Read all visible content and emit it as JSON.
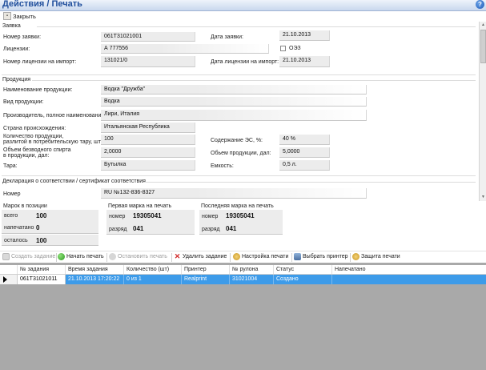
{
  "window": {
    "title": "Действия / Печать",
    "help": "?"
  },
  "closebar": {
    "close_label": "Закрыть"
  },
  "application": {
    "section": "Заявка",
    "number_label": "Номер заявки:",
    "number_value": "061T31021001",
    "date_label": "Дата заявки:",
    "date_value": "21.10.2013",
    "license_label": "Лицензии:",
    "license_value": "А 777556",
    "oez_label": "ОЭЗ",
    "import_license_label": "Номер лицензии на импорт:",
    "import_license_value": "131021/0",
    "import_date_label": "Дата лицензии на импорт:",
    "import_date_value": "21.10.2013"
  },
  "product": {
    "section": "Продукция",
    "name_label": "Наименование продукции:",
    "name_value": "Водка \"Дружба\"",
    "kind_label": "Вид продукции:",
    "kind_value": "Водка",
    "producer_label": "Производитель, полное наименование",
    "producer_value": "Лири, Италия",
    "country_label": "Страна происхождения:",
    "country_value": "Итальянская Республика",
    "qty_label_1": "Количество продукции,",
    "qty_label_2": "разлитой в потребительскую тару, шт:",
    "qty_value": "100",
    "alc_label": "Содержание ЭС, %:",
    "alc_value": "40 %",
    "spirit_label_1": "Объем безводного спирта",
    "spirit_label_2": "в продукции, дал:",
    "spirit_value": "2,0000",
    "volume_label": "Обьем продукции, дал:",
    "volume_value": "5,0000",
    "tare_label": "Тара:",
    "tare_value": "Бутылка",
    "capacity_label": "Емкость:",
    "capacity_value": "0,5 л."
  },
  "declaration": {
    "section": "Декларация о соответствии / сертификат соответствия",
    "number_label": "Номер",
    "number_value": "RU №132-836-8327"
  },
  "marks": {
    "title": "Марок в позиции",
    "total_label": "всего",
    "total_value": "100",
    "printed_label": "напечатано",
    "printed_value": "0",
    "left_label": "осталось",
    "left_value": "100"
  },
  "first_mark": {
    "title": "Первая марка на печать",
    "number_label": "номер",
    "number_value": "19305041",
    "rank_label": "разряд",
    "rank_value": "041"
  },
  "last_mark": {
    "title": "Последняя  марка на печать",
    "number_label": "номер",
    "number_value": "19305041",
    "rank_label": "разряд",
    "rank_value": "041"
  },
  "toolbar": {
    "create": "Создать задание",
    "start": "Начать печать",
    "stop": "Остановить печать",
    "delete": "Удалить задание",
    "settings": "Настройка печати",
    "printer": "Выбрать принтер",
    "protect": "Защита печати"
  },
  "grid": {
    "columns": [
      "№ задания",
      "Время задания",
      "Количество (шт)",
      "Принтер",
      "№ рулона",
      "Статус",
      "Напечатано"
    ],
    "rows": [
      [
        "061T31021011",
        "21.10.2013 17:20:22",
        "0 из 1",
        "Realprint",
        "31021004",
        "Создано",
        ""
      ]
    ]
  },
  "colors": {
    "title": "#1f4e9c",
    "row_selected": "#3d9be9",
    "grid_bg": "#a9a9a9"
  }
}
